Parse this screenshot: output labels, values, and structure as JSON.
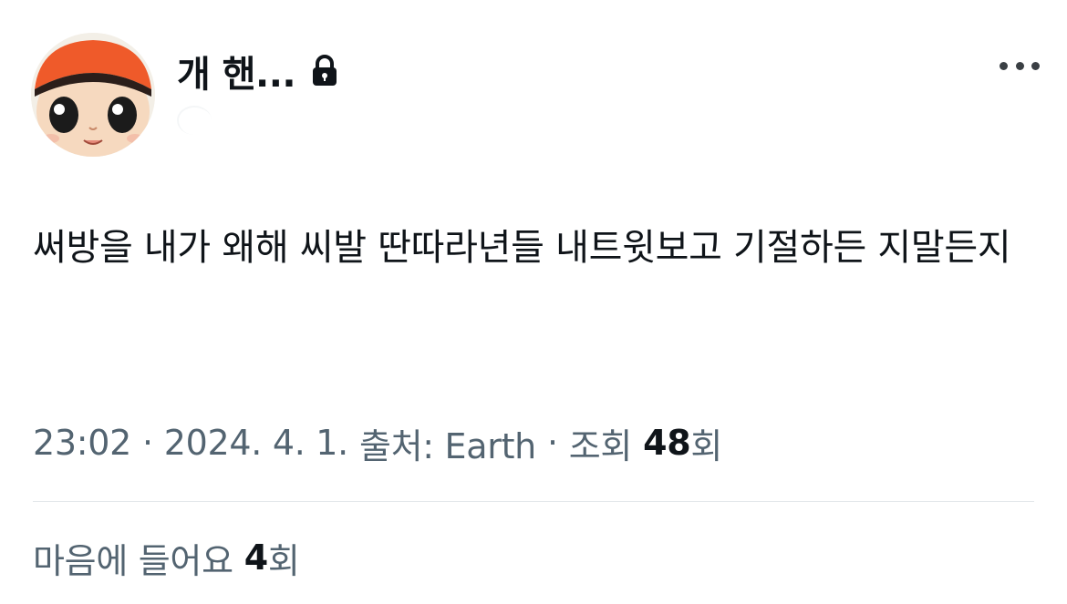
{
  "author": {
    "display_name": "개 핸...",
    "protected_icon": "lock-icon",
    "avatar_description_icon": "cartoon-avatar"
  },
  "more_icon": "more-horizontal-icon",
  "tweet": {
    "text": "써방을 내가 왜해 씨발 딴따라년들 내트윗보고 기절하든 지말든지"
  },
  "meta": {
    "time": "23:02",
    "date": "2024. 4. 1.",
    "source_label": "출처: Earth",
    "views_label": "조회",
    "views_count": "48",
    "views_unit": "회",
    "separator": "·"
  },
  "likes": {
    "label": "마음에 들어요",
    "count": "4",
    "unit": "회"
  },
  "colors": {
    "text_primary": "#0f1419",
    "text_secondary": "#536471",
    "divider": "#e4e8eb",
    "avatar_hat": "#ef5a2a"
  }
}
